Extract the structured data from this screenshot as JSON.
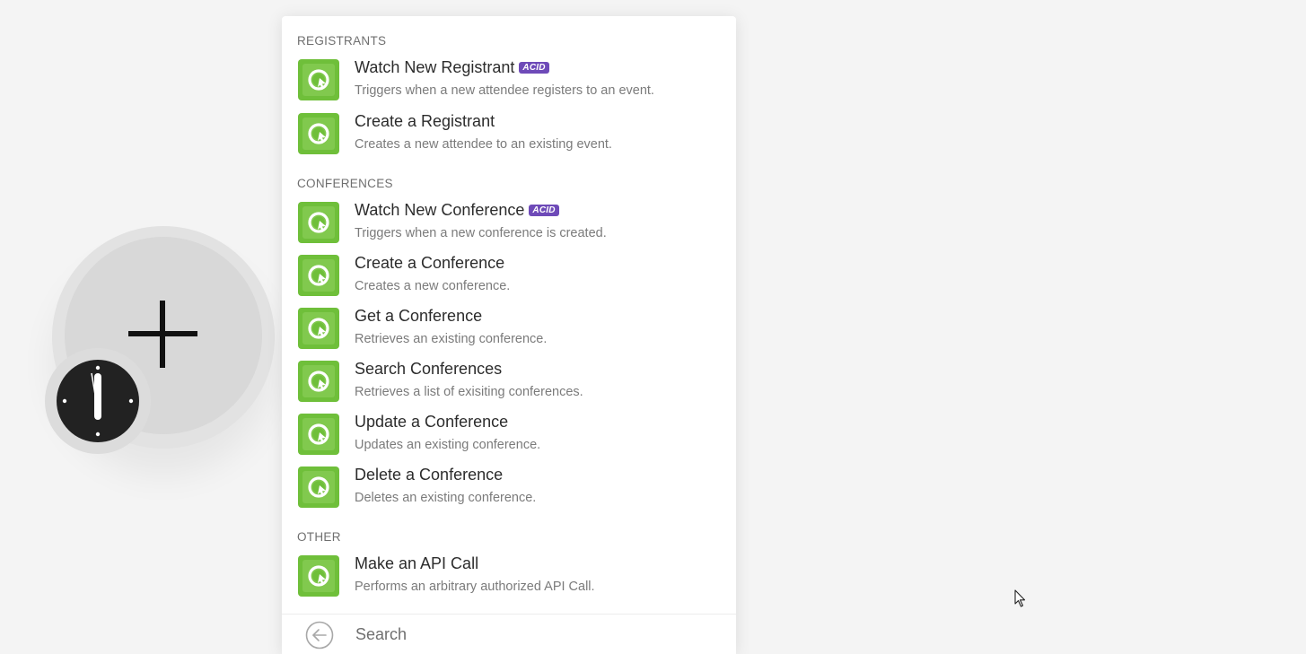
{
  "sections": [
    {
      "header": "REGISTRANTS",
      "items": [
        {
          "title": "Watch New Registrant",
          "badge": "ACID",
          "description": "Triggers when a new attendee registers to an event."
        },
        {
          "title": "Create a Registrant",
          "badge": "",
          "description": "Creates a new attendee to an existing event."
        }
      ]
    },
    {
      "header": "CONFERENCES",
      "items": [
        {
          "title": "Watch New Conference",
          "badge": "ACID",
          "description": "Triggers when a new conference is created."
        },
        {
          "title": "Create a Conference",
          "badge": "",
          "description": "Creates a new conference."
        },
        {
          "title": "Get a Conference",
          "badge": "",
          "description": "Retrieves an existing conference."
        },
        {
          "title": "Search Conferences",
          "badge": "",
          "description": "Retrieves a list of exisiting conferences."
        },
        {
          "title": "Update a Conference",
          "badge": "",
          "description": "Updates an existing conference."
        },
        {
          "title": "Delete a Conference",
          "badge": "",
          "description": "Deletes an existing conference."
        }
      ]
    },
    {
      "header": "OTHER",
      "items": [
        {
          "title": "Make an API Call",
          "badge": "",
          "description": "Performs an arbitrary authorized API Call."
        }
      ]
    }
  ],
  "search": {
    "placeholder": "Search",
    "value": ""
  },
  "icons": {
    "app_icon": "app-logo-icon",
    "back": "arrow-left-circle-icon",
    "add": "plus-icon",
    "schedule": "clock-icon",
    "pointer": "mouse-cursor-icon"
  },
  "colors": {
    "app_icon_bg": "#6fbf3a",
    "badge_bg": "#6e4ab8",
    "canvas_bg": "#f4f4f4"
  }
}
